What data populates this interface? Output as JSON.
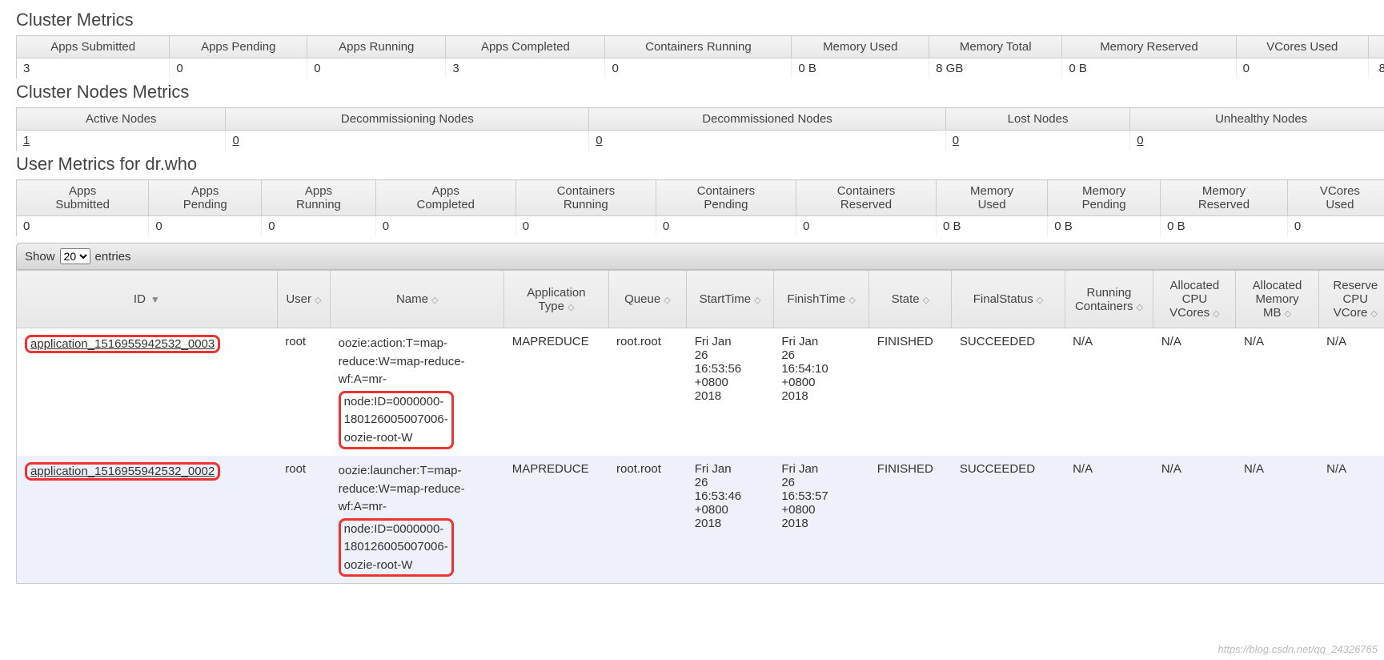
{
  "sections": {
    "clusterMetrics": "Cluster Metrics",
    "clusterNodes": "Cluster Nodes Metrics",
    "userMetrics": "User Metrics for dr.who"
  },
  "clusterMetrics": {
    "headers": [
      "Apps Submitted",
      "Apps Pending",
      "Apps Running",
      "Apps Completed",
      "Containers Running",
      "Memory Used",
      "Memory Total",
      "Memory Reserved",
      "VCores Used"
    ],
    "values": [
      "3",
      "0",
      "0",
      "3",
      "0",
      "0 B",
      "8 GB",
      "0 B",
      "0"
    ],
    "lastVal": "8"
  },
  "nodesMetrics": {
    "headers": [
      "Active Nodes",
      "Decommissioning Nodes",
      "Decommissioned Nodes",
      "Lost Nodes",
      "Unhealthy Nodes"
    ],
    "values": [
      "1",
      "0",
      "0",
      "0",
      "0"
    ]
  },
  "userMetrics": {
    "headers": [
      "Apps Submitted",
      "Apps Pending",
      "Apps Running",
      "Apps Completed",
      "Containers Running",
      "Containers Pending",
      "Containers Reserved",
      "Memory Used",
      "Memory Pending",
      "Memory Reserved",
      "VCores Used"
    ],
    "values": [
      "0",
      "0",
      "0",
      "0",
      "0",
      "0",
      "0",
      "0 B",
      "0 B",
      "0 B",
      "0"
    ]
  },
  "toolbar": {
    "show": "Show",
    "entries": "entries",
    "pageSize": "20"
  },
  "apps": {
    "headers": [
      "ID",
      "User",
      "Name",
      "Application Type",
      "Queue",
      "StartTime",
      "FinishTime",
      "State",
      "FinalStatus",
      "Running Containers",
      "Allocated CPU VCores",
      "Allocated Memory MB",
      "Reserve CPU VCore"
    ],
    "rows": [
      {
        "id": "application_1516955942532_0003",
        "user": "root",
        "namePre": "oozie:action:T=map-reduce:W=map-reduce-wf:A=mr-",
        "nameHi": "node:ID=0000000-180126005007006-oozie-root-W",
        "type": "MAPREDUCE",
        "queue": "root.root",
        "start": "Fri Jan 26 16:53:56 +0800 2018",
        "finish": "Fri Jan 26 16:54:10 +0800 2018",
        "state": "FINISHED",
        "final": "SUCCEEDED",
        "rc": "N/A",
        "cpu": "N/A",
        "mem": "N/A",
        "rcpu": "N/A"
      },
      {
        "id": "application_1516955942532_0002",
        "user": "root",
        "namePre": "oozie:launcher:T=map-reduce:W=map-reduce-wf:A=mr-",
        "nameHi": "node:ID=0000000-180126005007006-oozie-root-W",
        "type": "MAPREDUCE",
        "queue": "root.root",
        "start": "Fri Jan 26 16:53:46 +0800 2018",
        "finish": "Fri Jan 26 16:53:57 +0800 2018",
        "state": "FINISHED",
        "final": "SUCCEEDED",
        "rc": "N/A",
        "cpu": "N/A",
        "mem": "N/A",
        "rcpu": "N/A"
      }
    ]
  },
  "watermark": "https://blog.csdn.net/qq_24326765"
}
